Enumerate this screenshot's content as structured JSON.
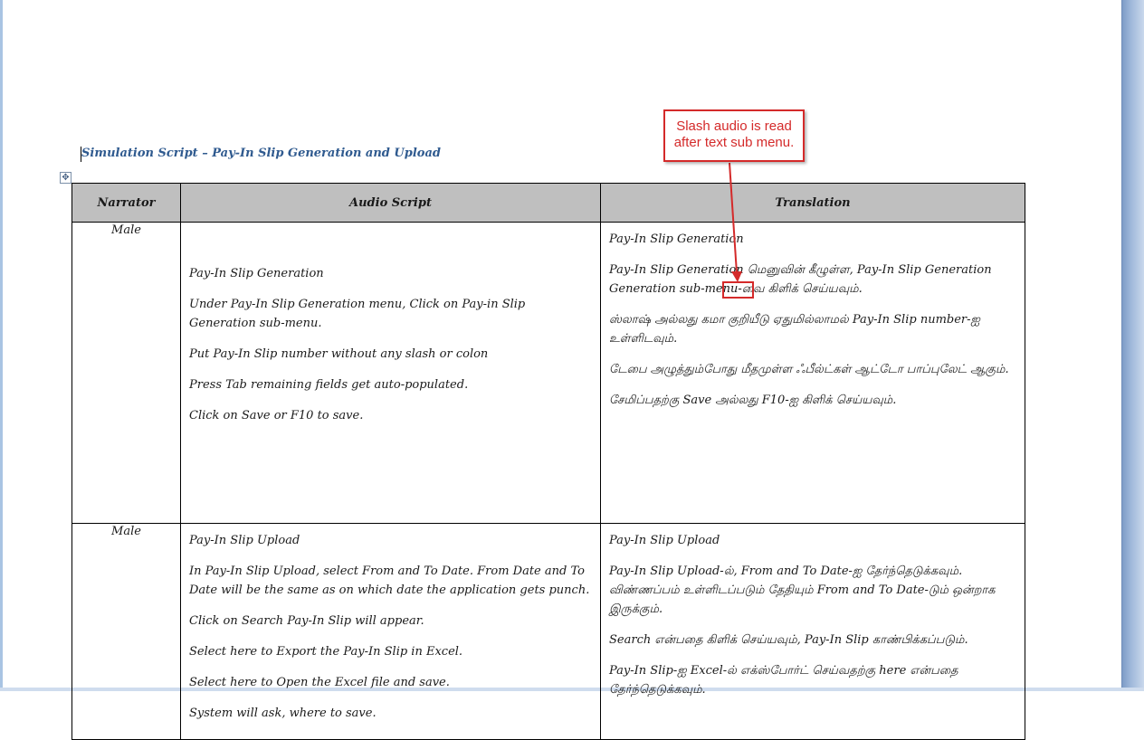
{
  "document": {
    "title": "Simulation Script – Pay-In Slip Generation and Upload"
  },
  "table": {
    "headers": {
      "narrator": "Narrator",
      "audio": "Audio Script",
      "translation": "Translation"
    },
    "rows": [
      {
        "narrator": "Male",
        "audio": [
          "Pay-In Slip Generation",
          "Under Pay-In Slip Generation menu, Click on Pay-in Slip Generation sub-menu.",
          "Put Pay-In Slip number without any slash or colon",
          "Press Tab remaining fields  get auto-populated.",
          "Click on Save or F10 to save."
        ],
        "translation": [
          "Pay-In Slip Generation",
          "Pay-In Slip Generation மெனுவின் கீழுள்ள, Pay-In Slip Generation Generation sub-menu-வை கிளிக் செய்யவும்.",
          "ஸ்லாஷ் அல்லது கமா குறியீடு ஏதுமில்லாமல் Pay-In Slip number-ஐ உள்ளிடவும்.",
          "டேபை அழுத்தும்போது மீதமுள்ள ஃபீல்ட்கள் ஆட்டோ பாப்புலேட் ஆகும்.",
          "சேமிப்பதற்கு Save அல்லது F10-ஐ கிளிக் செய்யவும்."
        ]
      },
      {
        "narrator": "Male",
        "audio": [
          "Pay-In Slip Upload",
          "In Pay-In Slip Upload, select From and To Date. From Date and To Date will be the same as on which date the application gets punch.",
          "Click on Search Pay-In Slip will appear.",
          "Select here to Export the Pay-In Slip in Excel.",
          "Select here to Open the Excel file and save.",
          "System will ask, where to save."
        ],
        "translation": [
          "Pay-In Slip Upload",
          "Pay-In Slip Upload-ல், From and To Date-ஐ தேர்ந்தெடுக்கவும். விண்ணப்பம் உள்ளிடப்படும் தேதியும் From and To Date-டும் ஒன்றாக இருக்கும்.",
          "Search என்பதை கிளிக் செய்யவும், Pay-In Slip காண்பிக்கப்படும்.",
          "Pay-In Slip-ஐ Excel-ல் எக்ஸ்போர்ட் செய்வதற்கு here என்பதை தேர்ந்தெடுக்கவும்."
        ]
      }
    ]
  },
  "callout": {
    "text": "Slash audio is read after text sub menu.",
    "color": "#d42a2a"
  },
  "icons": {
    "table_move_handle": "move-cross-icon"
  }
}
